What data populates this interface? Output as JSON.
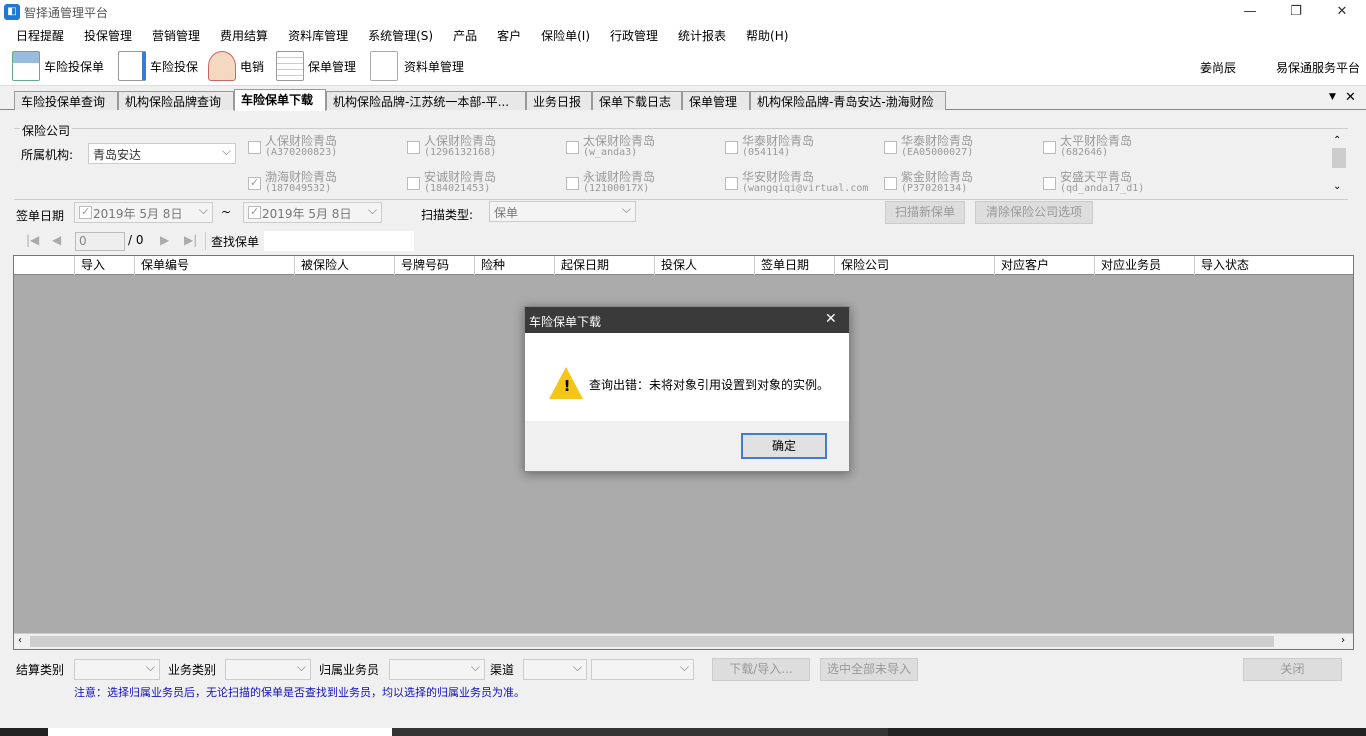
{
  "window": {
    "title": "智择通管理平台",
    "minimize": "—",
    "restore": "❐",
    "close": "✕"
  },
  "menu": [
    "日程提醒",
    "投保管理",
    "营销管理",
    "费用结算",
    "资料库管理",
    "系统管理(S)",
    "产品",
    "客户",
    "保险单(I)",
    "行政管理",
    "统计报表",
    "帮助(H)"
  ],
  "toolbar": {
    "buttons": [
      "车险投保单",
      "车险投保",
      "电销",
      "保单管理",
      "资料单管理"
    ],
    "user": "姜尚辰",
    "platform": "易保通服务平台"
  },
  "tabs": [
    "车险投保单查询",
    "机构保险品牌查询",
    "车险保单下载",
    "机构保险品牌-江苏统一本部-平...",
    "业务日报",
    "保单下载日志",
    "保单管理",
    "机构保险品牌-青岛安达-渤海财险"
  ],
  "tab_controls": {
    "dropdown": "▼",
    "close": "✕"
  },
  "filter": {
    "group_label": "保险公司",
    "org_label": "所属机构:",
    "org_value": "青岛安达",
    "companies": [
      {
        "name": "人保财险青岛",
        "code": "(A370200823)",
        "checked": false
      },
      {
        "name": "人保财险青岛",
        "code": "(1296132168)",
        "checked": false
      },
      {
        "name": "太保财险青岛",
        "code": "(w_anda3)",
        "checked": false
      },
      {
        "name": "华泰财险青岛",
        "code": "(054114)",
        "checked": false
      },
      {
        "name": "华泰财险青岛",
        "code": "(EA05000027)",
        "checked": false
      },
      {
        "name": "太平财险青岛",
        "code": "(682646)",
        "checked": false
      },
      {
        "name": "渤海财险青岛",
        "code": "(187049532)",
        "checked": true
      },
      {
        "name": "安诚财险青岛",
        "code": "(184021453)",
        "checked": false
      },
      {
        "name": "永诚财险青岛",
        "code": "(12100017X)",
        "checked": false
      },
      {
        "name": "华安财险青岛",
        "code": "(wangqiqi@virtual.com",
        "checked": false
      },
      {
        "name": "紫金财险青岛",
        "code": "(P37020134)",
        "checked": false
      },
      {
        "name": "安盛天平青岛",
        "code": "(qd_anda17_d1)",
        "checked": false
      }
    ],
    "date_label": "签单日期",
    "date_from": "2019年 5月 8日",
    "date_sep": "~",
    "date_to": "2019年 5月 8日",
    "scan_type_label": "扫描类型:",
    "scan_type_value": "保单",
    "scan_button": "扫描新保单",
    "clear_button": "清除保险公司选项"
  },
  "navigator": {
    "position": "0",
    "total": "/ 0",
    "find_label": "查找保单"
  },
  "grid": {
    "columns": [
      "导入",
      "保单编号",
      "被保险人",
      "号牌号码",
      "险种",
      "起保日期",
      "投保人",
      "签单日期",
      "保险公司",
      "对应客户",
      "对应业务员",
      "导入状态"
    ]
  },
  "bottom": {
    "settle_label": "结算类别",
    "biz_label": "业务类别",
    "salesman_label": "归属业务员",
    "channel_label": "渠道",
    "download_button": "下载/导入...",
    "select_all_button": "选中全部未导入",
    "close_button": "关闭",
    "notice": "注意：选择归属业务员后，无论扫描的保单是否查找到业务员，均以选择的归属业务员为准。"
  },
  "dialog": {
    "title": "车险保单下载",
    "message": "查询出错：未将对象引用设置到对象的实例。",
    "ok": "确定",
    "close": "✕",
    "icon": "!"
  },
  "colors": {
    "accent": "#3c7fd0",
    "grid_bg": "#ababab",
    "dialog_title": "#3a3a3a",
    "notice": "#1010c0"
  }
}
